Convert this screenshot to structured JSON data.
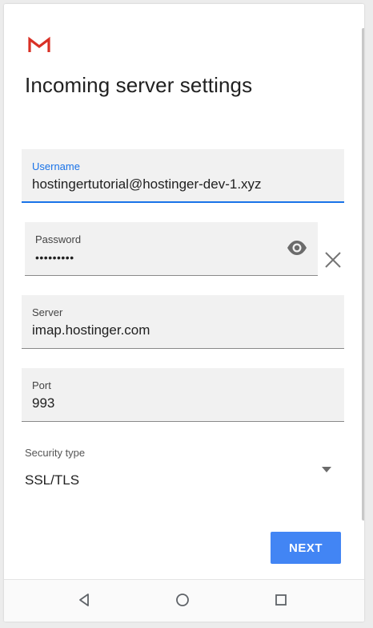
{
  "header": {
    "app_icon": "gmail-logo-icon",
    "title": "Incoming server settings"
  },
  "form": {
    "username": {
      "label": "Username",
      "value": "hostingertutorial@hostinger-dev-1.xyz"
    },
    "password": {
      "label": "Password",
      "value": "•••••••••",
      "toggle_icon": "eye-icon",
      "clear_icon": "close-icon"
    },
    "server": {
      "label": "Server",
      "value": "imap.hostinger.com"
    },
    "port": {
      "label": "Port",
      "value": "993"
    },
    "security": {
      "label": "Security type",
      "value": "SSL/TLS",
      "dropdown_icon": "dropdown-arrow-icon"
    }
  },
  "actions": {
    "next_label": "NEXT"
  },
  "navigation": {
    "back_icon": "back-triangle-icon",
    "home_icon": "home-circle-icon",
    "recents_icon": "recents-square-icon"
  },
  "colors": {
    "accent": "#1a73e8",
    "button": "#4285f4",
    "field_bg": "#f1f1f1",
    "gmail_red": "#d93025"
  }
}
